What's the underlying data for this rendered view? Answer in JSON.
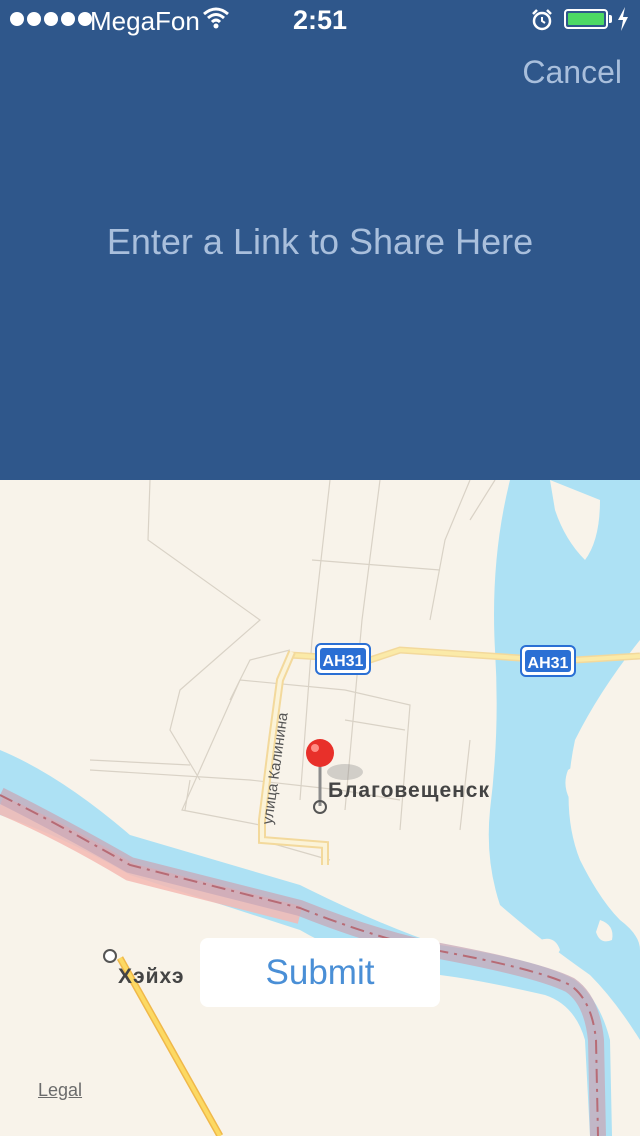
{
  "status_bar": {
    "carrier": "MegaFon",
    "time": "2:51",
    "battery_level": 1.0
  },
  "share": {
    "cancel_label": "Cancel",
    "link_placeholder": "Enter a Link to Share Here",
    "link_value": ""
  },
  "map": {
    "city_label": "Благовещенск",
    "street_label": "улица Калинина",
    "route_badge_1": "AH31",
    "route_badge_2": "AH31",
    "town_label": "Хэйхэ",
    "legal_label": "Legal",
    "pin_color": "#e8302a",
    "water_color": "#ade1f4",
    "land_color": "#f8f3ea"
  },
  "submit_label": "Submit",
  "colors": {
    "header_bg": "#2f578b",
    "accent": "#4a8fd6"
  }
}
